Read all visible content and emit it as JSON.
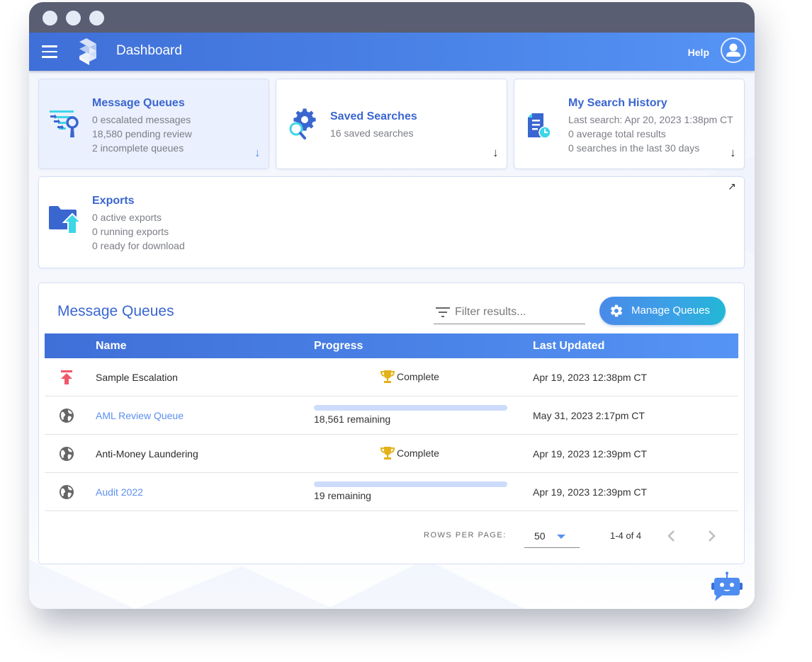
{
  "window": {
    "controls": [
      "close",
      "minimize",
      "maximize"
    ]
  },
  "appbar": {
    "title": "Dashboard",
    "help_label": "Help",
    "menu_icon": "hamburger-menu-icon",
    "logo_icon": "stacked-layers-logo",
    "user_icon": "user-account-icon"
  },
  "cards": {
    "message_queues": {
      "title": "Message Queues",
      "lines": [
        "0 escalated messages",
        "18,580 pending review",
        "2 incomplete queues"
      ],
      "icon": "queue-search-icon",
      "action_icon": "arrow-down-icon",
      "active": true
    },
    "saved_searches": {
      "title": "Saved Searches",
      "lines": [
        "16 saved searches"
      ],
      "icon": "gear-search-icon",
      "action_icon": "arrow-down-icon"
    },
    "search_history": {
      "title": "My Search History",
      "lines": [
        "Last search: Apr 20, 2023 1:38pm CT",
        "0 average total results",
        "0 searches in the last 30 days"
      ],
      "icon": "document-clock-icon",
      "action_icon": "arrow-down-icon"
    },
    "exports": {
      "title": "Exports",
      "lines": [
        "0 active exports",
        "0 running exports",
        "0 ready for download"
      ],
      "icon": "folder-upload-icon",
      "action_icon": "external-link-arrow-icon"
    }
  },
  "queues_panel": {
    "title": "Message Queues",
    "filter_placeholder": "Filter results...",
    "filter_value": "",
    "manage_button_label": "Manage Queues",
    "columns": [
      "Name",
      "Progress",
      "Last Updated"
    ],
    "rows": [
      {
        "type_icon": "escalation-icon",
        "name": "Sample Escalation",
        "is_link": false,
        "progress": {
          "complete": true,
          "label": "Complete"
        },
        "last_updated": "Apr 19, 2023 12:38pm CT"
      },
      {
        "type_icon": "globe-icon",
        "name": "AML Review Queue",
        "is_link": true,
        "progress": {
          "complete": false,
          "fraction": 0,
          "label": "18,561 remaining"
        },
        "last_updated": "May 31, 2023 2:17pm CT"
      },
      {
        "type_icon": "globe-icon",
        "name": "Anti-Money Laundering",
        "is_link": false,
        "progress": {
          "complete": true,
          "label": "Complete"
        },
        "last_updated": "Apr 19, 2023 12:39pm CT"
      },
      {
        "type_icon": "globe-icon",
        "name": "Audit 2022",
        "is_link": true,
        "progress": {
          "complete": false,
          "fraction": 0,
          "label": "19 remaining"
        },
        "last_updated": "Apr 19, 2023 12:39pm CT"
      }
    ],
    "pagination": {
      "rows_per_page_label": "ROWS PER PAGE:",
      "rows_per_page": "50",
      "range": "1-4 of 4"
    }
  },
  "colors": {
    "accent": "#3a66d0",
    "link": "#5b8ff0",
    "escalation": "#f0586a",
    "trophy": "#e3b21a",
    "cyan": "#3dd6e8"
  }
}
